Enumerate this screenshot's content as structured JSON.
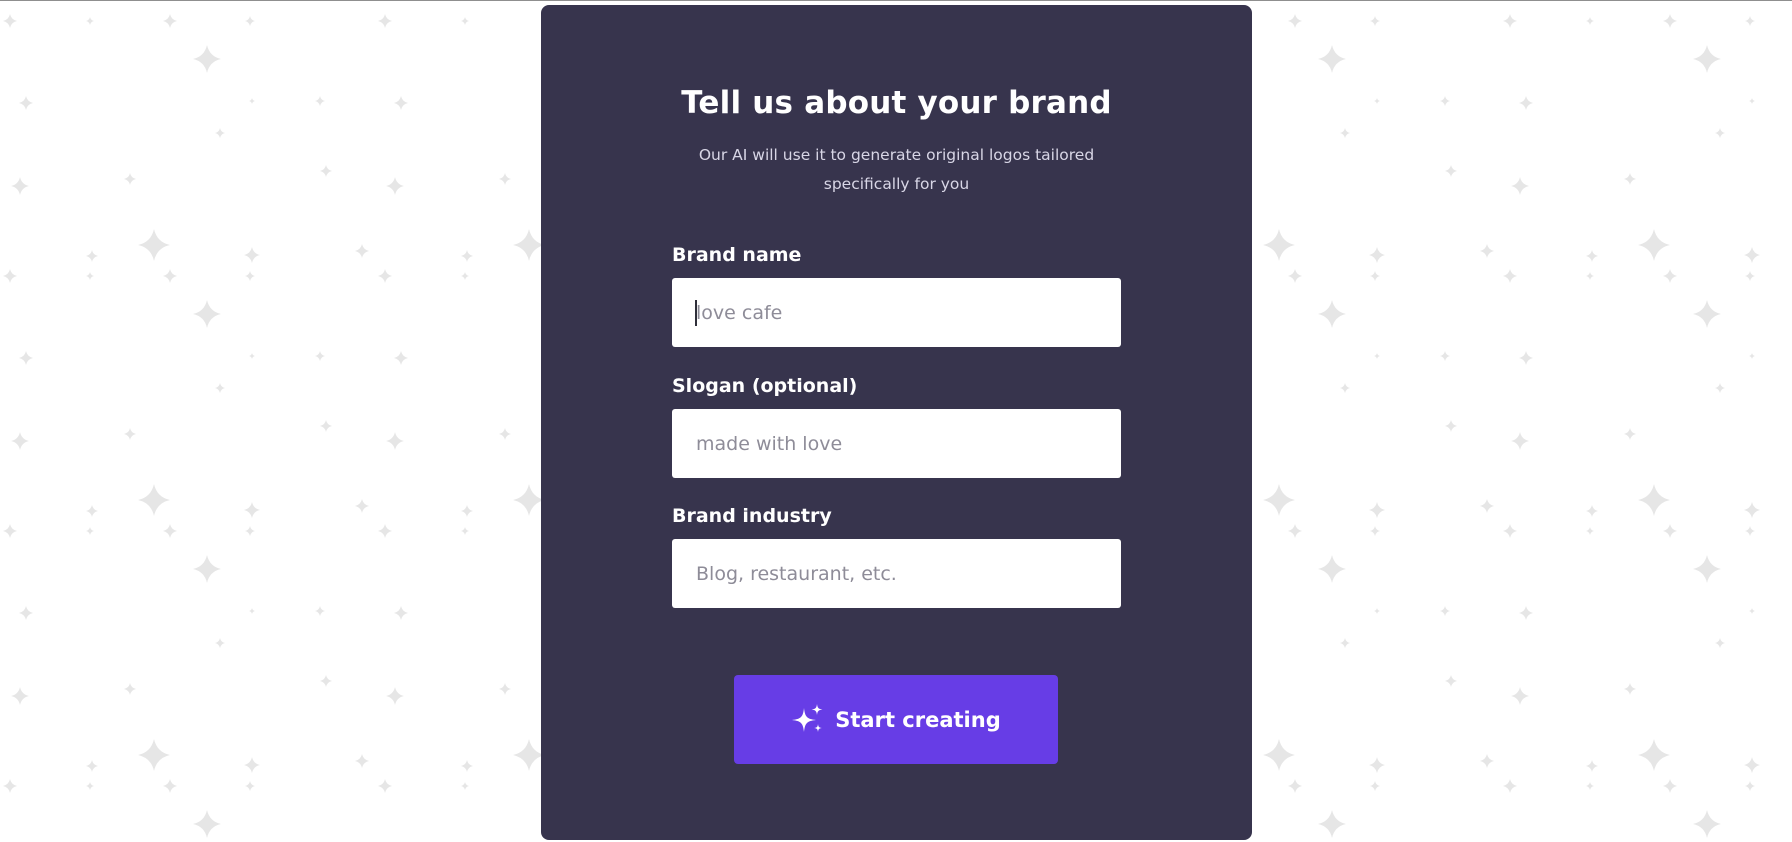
{
  "colors": {
    "card_bg": "#37344d",
    "accent": "#673de6",
    "page_bg": "#ffffff",
    "star_color": "#e6e6e6"
  },
  "form": {
    "title": "Tell us about your brand",
    "subtitle": "Our AI will use it to generate original logos tailored specifically for you",
    "fields": [
      {
        "label": "Brand name",
        "value": "",
        "placeholder": "love cafe"
      },
      {
        "label": "Slogan (optional)",
        "value": "",
        "placeholder": "made with love"
      },
      {
        "label": "Brand industry",
        "value": "",
        "placeholder": "Blog, restaurant, etc."
      }
    ],
    "submit_label": "Start creating",
    "submit_icon": "sparkles-icon"
  },
  "background": {
    "decoration_icon": "sparkle-star-icon"
  }
}
